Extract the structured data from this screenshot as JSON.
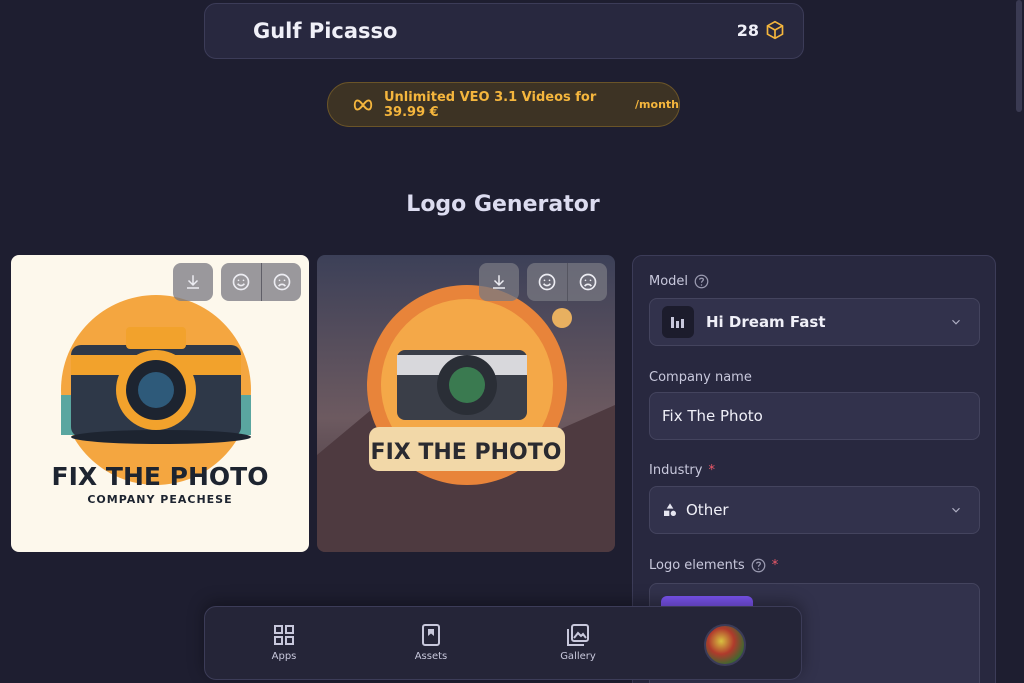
{
  "header": {
    "brand": "Gulf Picasso",
    "credits": "28",
    "credits_icon": "cube-coin-icon"
  },
  "promo": {
    "text": "Unlimited VEO 3.1 Videos for 39.99 €",
    "suffix": "/month",
    "icon": "infinity-icon",
    "color": "#f5b63d"
  },
  "page": {
    "title": "Logo Generator"
  },
  "results": [
    {
      "line1": "FIX THE PHOTO",
      "line2": "COMPANY PEACHESE"
    },
    {
      "line1": "FIX THE PHOTO"
    }
  ],
  "form": {
    "model": {
      "label": "Model",
      "value": "Hi Dream Fast"
    },
    "company": {
      "label": "Company name",
      "value": "Fix The Photo"
    },
    "industry": {
      "label": "Industry",
      "required": "*",
      "value": "Other"
    },
    "elements": {
      "label": "Logo elements",
      "required": "*"
    }
  },
  "nav": [
    {
      "label": "Apps",
      "icon": "grid-icon"
    },
    {
      "label": "Assets",
      "icon": "bookmark-icon"
    },
    {
      "label": "Gallery",
      "icon": "gallery-icon"
    }
  ],
  "colors": {
    "accent": "#7a54f0",
    "background": "#1e1e30",
    "panel": "#28283f"
  }
}
